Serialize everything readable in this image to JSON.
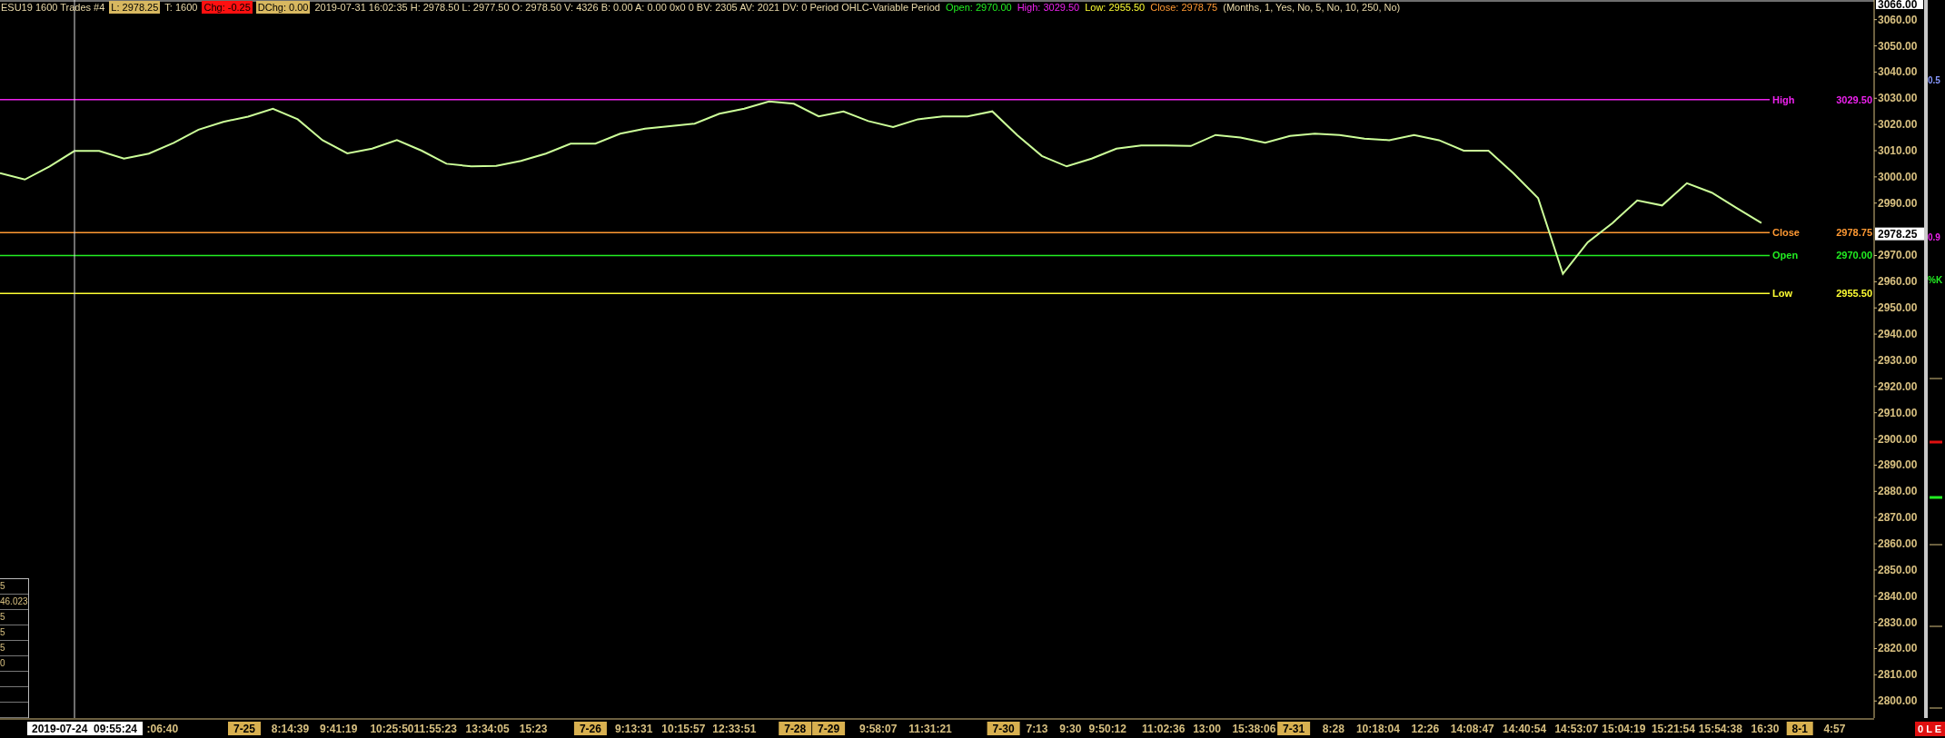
{
  "header": {
    "symbol": "ESU19  1600  Trades  #4",
    "fields": [
      {
        "kind": "boxed",
        "text": "L: 2978.25",
        "color": "#d8b860"
      },
      {
        "kind": "plain",
        "text": "T: 1600"
      },
      {
        "kind": "boxed",
        "text": "Chg: -0.25",
        "color": "#ff1010"
      },
      {
        "kind": "boxed",
        "text": "DChg: 0.00",
        "color": "#d8b860"
      },
      {
        "kind": "plain",
        "text": "2019-07-31 16:02:35 H: 2978.50 L: 2977.50 O: 2978.50 V: 4326 B: 0.00 A: 0.00 0x0 0 BV: 2305 AV: 2021 DV: 0 Period OHLC-Variable Period"
      },
      {
        "kind": "plain",
        "text": "Open: 2970.00",
        "color": "#22ee22"
      },
      {
        "kind": "plain",
        "text": "High: 3029.50",
        "color": "#ee22ee"
      },
      {
        "kind": "plain",
        "text": "Low: 2955.50",
        "color": "#ffff33"
      },
      {
        "kind": "plain",
        "text": "Close: 2978.75",
        "color": "#ff9933"
      },
      {
        "kind": "plain",
        "text": "(Months, 1, Yes, No, 5, No, 10, 250, No)"
      }
    ]
  },
  "chart_data": {
    "type": "line",
    "ylim": [
      2793.5,
      3067.5
    ],
    "yticks": [
      {
        "value": 2800,
        "label": "2800.00"
      },
      {
        "value": 2810,
        "label": "2810.00"
      },
      {
        "value": 2820,
        "label": "2820.00"
      },
      {
        "value": 2830,
        "label": "2830.00"
      },
      {
        "value": 2840,
        "label": "2840.00"
      },
      {
        "value": 2850,
        "label": "2850.00"
      },
      {
        "value": 2860,
        "label": "2860.00"
      },
      {
        "value": 2870,
        "label": "2870.00"
      },
      {
        "value": 2880,
        "label": "2880.00"
      },
      {
        "value": 2890,
        "label": "2890.00"
      },
      {
        "value": 2900,
        "label": "2900.00"
      },
      {
        "value": 2910,
        "label": "2910.00"
      },
      {
        "value": 2920,
        "label": "2920.00"
      },
      {
        "value": 2930,
        "label": "2930.00"
      },
      {
        "value": 2940,
        "label": "2940.00"
      },
      {
        "value": 2950,
        "label": "2950.00"
      },
      {
        "value": 2960,
        "label": "2960.00"
      },
      {
        "value": 2970,
        "label": "2970.00"
      },
      {
        "value": 2990,
        "label": "2990.00"
      },
      {
        "value": 3000,
        "label": "3000.00"
      },
      {
        "value": 3010,
        "label": "3010.00"
      },
      {
        "value": 3020,
        "label": "3020.00"
      },
      {
        "value": 3030,
        "label": "3030.00"
      },
      {
        "value": 3040,
        "label": "3040.00"
      },
      {
        "value": 3050,
        "label": "3050.00"
      },
      {
        "value": 3060,
        "label": "3060.00"
      }
    ],
    "series": [
      {
        "color": "#ccff99",
        "values": [
          3001.4,
          2999,
          3004,
          3009.9,
          3009.9,
          3007,
          3008.9,
          3013,
          3018,
          3021,
          3023,
          3026,
          3022,
          3014,
          3009,
          3010.8,
          3014,
          3010,
          3005,
          3004,
          3004.2,
          3006.1,
          3008.9,
          3012.7,
          3012.7,
          3016.5,
          3018.4,
          3019.4,
          3020.3,
          3024.1,
          3026,
          3028.8,
          3027.9,
          3023.1,
          3025,
          3021.3,
          3019,
          3022,
          3023.1,
          3023.1,
          3025,
          3016,
          3008,
          3004,
          3007,
          3010.8,
          3012,
          3012,
          3011.8,
          3016,
          3015,
          3013,
          3015.6,
          3016.5,
          3016,
          3014.6,
          3014,
          3016,
          3014,
          3010,
          3010,
          3001.4,
          2991.9,
          2963,
          2975,
          2982.4,
          2991,
          2989.1,
          2997.6,
          2994,
          2988.1,
          2982.4
        ]
      }
    ],
    "ref_lines": [
      {
        "axis": "y",
        "value": 3029.5,
        "label": "High",
        "color": "#ee22ee"
      },
      {
        "axis": "y",
        "value": 2978.75,
        "label": "Close",
        "color": "#ff9933"
      },
      {
        "axis": "y",
        "value": 2970,
        "label": "Open",
        "color": "#22ee22"
      },
      {
        "axis": "y",
        "value": 2955.5,
        "label": "Low",
        "color": "#ffff33"
      }
    ]
  },
  "level_prices": [
    "3029.50",
    "2978.75",
    "2970.00",
    "2955.50"
  ],
  "price_axis": {
    "top_label": "3066.00",
    "last_price": "2978.25"
  },
  "time_axis": {
    "cursor_label": "2019-07-24  09:55:24",
    "labels": [
      {
        "kind": "time",
        "text": ":06:40"
      },
      {
        "kind": "date",
        "text": "7-25"
      },
      {
        "kind": "time",
        "text": "8:14:39"
      },
      {
        "kind": "time",
        "text": "9:41:19"
      },
      {
        "kind": "time",
        "text": "10:25:50"
      },
      {
        "kind": "time",
        "text": "11:55:23"
      },
      {
        "kind": "time",
        "text": "13:34:05"
      },
      {
        "kind": "time",
        "text": "15:23"
      },
      {
        "kind": "date",
        "text": "7-26"
      },
      {
        "kind": "time",
        "text": "9:13:31"
      },
      {
        "kind": "time",
        "text": "10:15:57"
      },
      {
        "kind": "time",
        "text": "12:33:51"
      },
      {
        "kind": "date",
        "text": "7-28"
      },
      {
        "kind": "date",
        "text": "7-29"
      },
      {
        "kind": "time",
        "text": "9:58:07"
      },
      {
        "kind": "time",
        "text": "11:31:21"
      },
      {
        "kind": "date",
        "text": "7-30"
      },
      {
        "kind": "time",
        "text": "7:13"
      },
      {
        "kind": "time",
        "text": "9:30"
      },
      {
        "kind": "time",
        "text": "9:50:12"
      },
      {
        "kind": "time",
        "text": "11:02:36"
      },
      {
        "kind": "time",
        "text": "13:00"
      },
      {
        "kind": "time",
        "text": "15:38:06"
      },
      {
        "kind": "date",
        "text": "7-31"
      },
      {
        "kind": "time",
        "text": "8:28"
      },
      {
        "kind": "time",
        "text": "10:18:04"
      },
      {
        "kind": "time",
        "text": "12:26"
      },
      {
        "kind": "time",
        "text": "14:08:47"
      },
      {
        "kind": "time",
        "text": "14:40:54"
      },
      {
        "kind": "time",
        "text": "14:53:07"
      },
      {
        "kind": "time",
        "text": "15:04:19"
      },
      {
        "kind": "time",
        "text": "15:21:54"
      },
      {
        "kind": "time",
        "text": "15:54:38"
      },
      {
        "kind": "time",
        "text": "16:30"
      },
      {
        "kind": "date",
        "text": "8-1"
      },
      {
        "kind": "time",
        "text": "4:57"
      }
    ]
  },
  "side_table": {
    "rows": [
      "5",
      "46.023",
      "5",
      "5",
      "5",
      "0"
    ]
  },
  "right_panel": {
    "labels": [
      {
        "text": "0.5",
        "color": "#8899ff"
      },
      {
        "text": "0.9",
        "color": "#ee22ee"
      },
      {
        "text": "%K",
        "color": "#22ee22"
      }
    ]
  },
  "status_box": "0 L E"
}
